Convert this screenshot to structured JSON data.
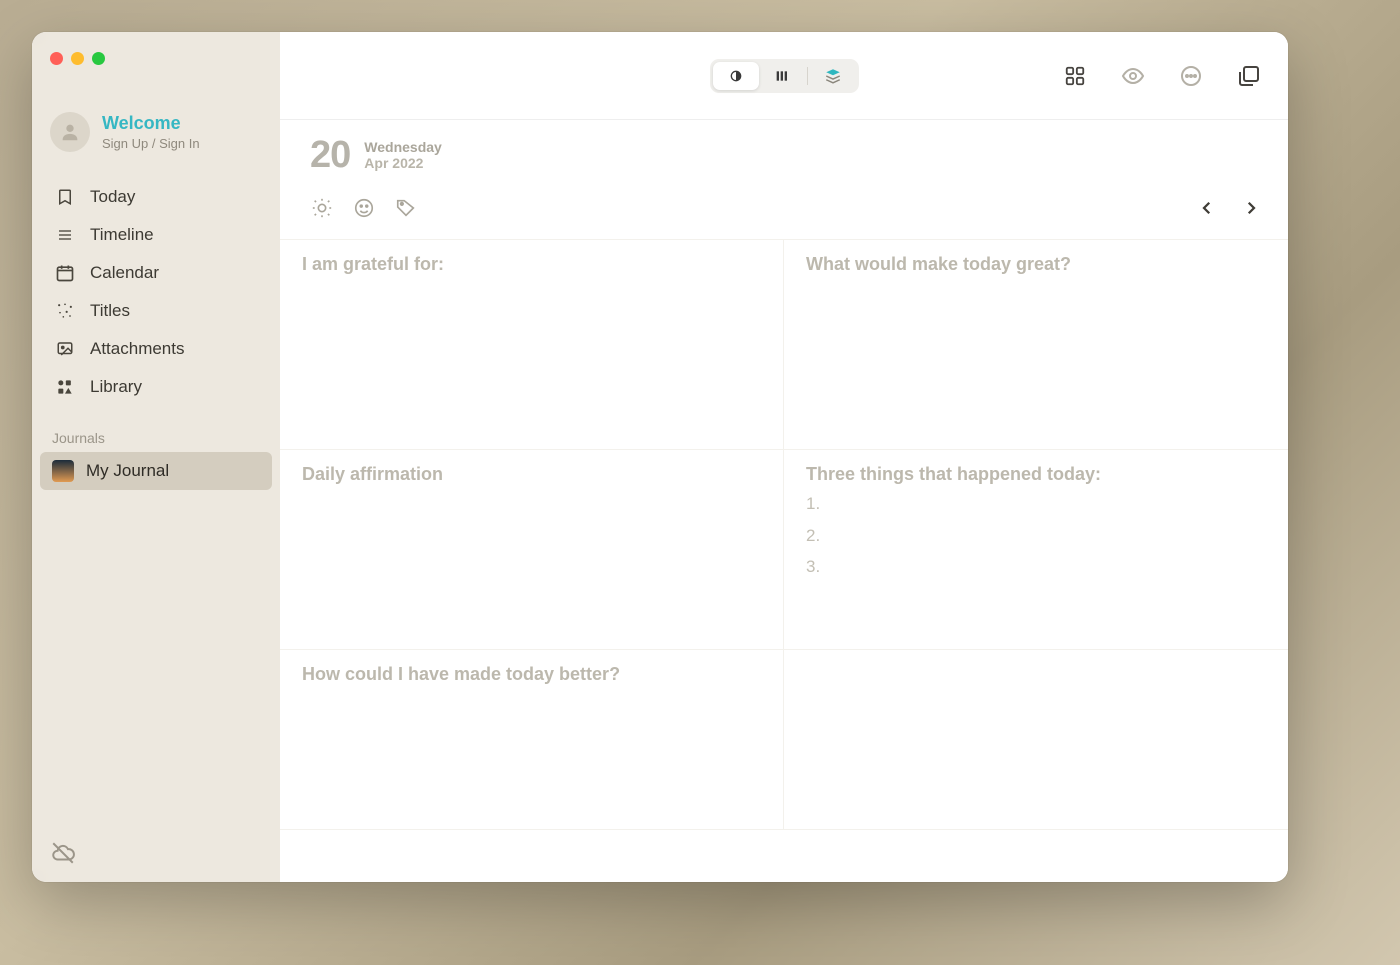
{
  "profile": {
    "name": "Welcome",
    "sublabel": "Sign Up / Sign In"
  },
  "sidebar": {
    "items": [
      {
        "label": "Today"
      },
      {
        "label": "Timeline"
      },
      {
        "label": "Calendar"
      },
      {
        "label": "Titles"
      },
      {
        "label": "Attachments"
      },
      {
        "label": "Library"
      }
    ],
    "section_label": "Journals",
    "journal": "My Journal"
  },
  "date": {
    "day": "20",
    "weekday": "Wednesday",
    "monthyear": "Apr 2022"
  },
  "prompts": {
    "grateful": "I am grateful for:",
    "great": "What would make today great?",
    "affirm": "Daily affirmation",
    "three": "Three things that happened today:",
    "three_items": [
      "1.",
      "2.",
      "3."
    ],
    "better": "How could I have made today better?",
    "empty_cell": ""
  }
}
